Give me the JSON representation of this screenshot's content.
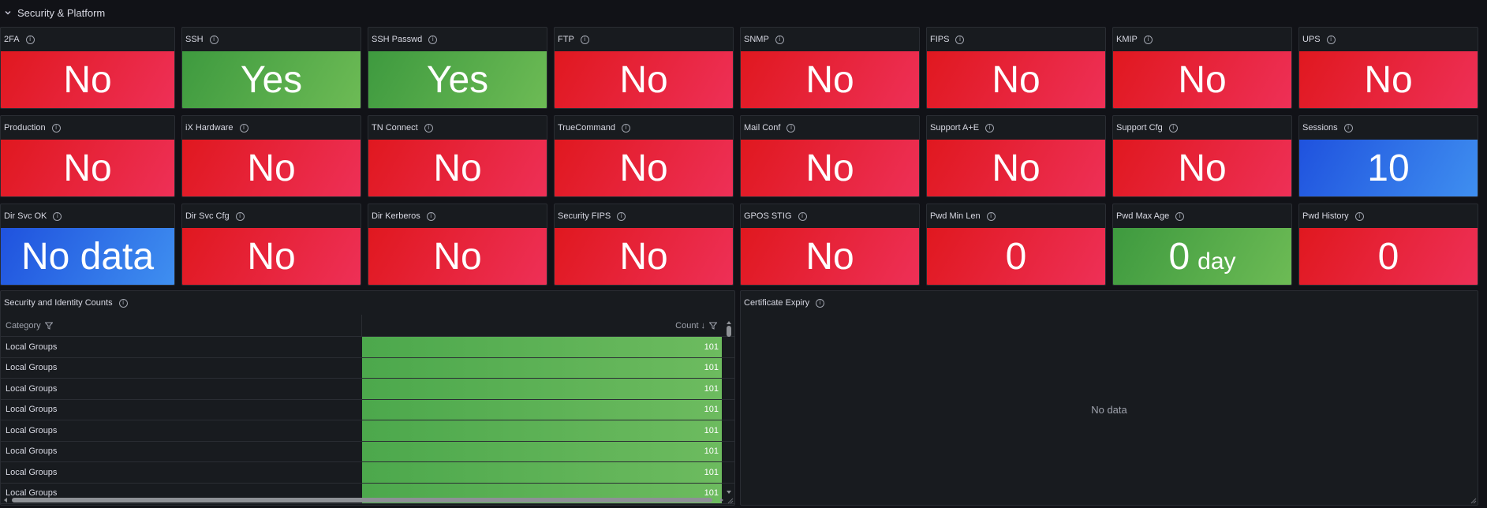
{
  "row": {
    "title": "Security & Platform"
  },
  "stats": [
    {
      "title": "2FA",
      "value": "No",
      "color": "red"
    },
    {
      "title": "SSH",
      "value": "Yes",
      "color": "green"
    },
    {
      "title": "SSH Passwd",
      "value": "Yes",
      "color": "green"
    },
    {
      "title": "FTP",
      "value": "No",
      "color": "red"
    },
    {
      "title": "SNMP",
      "value": "No",
      "color": "red"
    },
    {
      "title": "FIPS",
      "value": "No",
      "color": "red"
    },
    {
      "title": "KMIP",
      "value": "No",
      "color": "red"
    },
    {
      "title": "UPS",
      "value": "No",
      "color": "red"
    },
    {
      "title": "Production",
      "value": "No",
      "color": "red"
    },
    {
      "title": "iX Hardware",
      "value": "No",
      "color": "red"
    },
    {
      "title": "TN Connect",
      "value": "No",
      "color": "red"
    },
    {
      "title": "TrueCommand",
      "value": "No",
      "color": "red"
    },
    {
      "title": "Mail Conf",
      "value": "No",
      "color": "red"
    },
    {
      "title": "Support A+E",
      "value": "No",
      "color": "red"
    },
    {
      "title": "Support Cfg",
      "value": "No",
      "color": "red"
    },
    {
      "title": "Sessions",
      "value": "10",
      "color": "blue"
    },
    {
      "title": "Dir Svc OK",
      "value": "No data",
      "color": "blue"
    },
    {
      "title": "Dir Svc Cfg",
      "value": "No",
      "color": "red"
    },
    {
      "title": "Dir Kerberos",
      "value": "No",
      "color": "red"
    },
    {
      "title": "Security FIPS",
      "value": "No",
      "color": "red"
    },
    {
      "title": "GPOS STIG",
      "value": "No",
      "color": "red"
    },
    {
      "title": "Pwd Min Len",
      "value": "0",
      "color": "red"
    },
    {
      "title": "Pwd Max Age",
      "value": "0",
      "unit": "day",
      "color": "green"
    },
    {
      "title": "Pwd History",
      "value": "0",
      "color": "red"
    }
  ],
  "table": {
    "title": "Security and Identity Counts",
    "col_category": "Category",
    "col_count": "Count",
    "rows": [
      {
        "category": "Local Groups",
        "count": "101"
      },
      {
        "category": "Local Groups",
        "count": "101"
      },
      {
        "category": "Local Groups",
        "count": "101"
      },
      {
        "category": "Local Groups",
        "count": "101"
      },
      {
        "category": "Local Groups",
        "count": "101"
      },
      {
        "category": "Local Groups",
        "count": "101"
      },
      {
        "category": "Local Groups",
        "count": "101"
      },
      {
        "category": "Local Groups",
        "count": "101"
      }
    ]
  },
  "cert": {
    "title": "Certificate Expiry",
    "empty_text": "No data"
  },
  "colors": {
    "red": "#e0181f",
    "green": "#56a64b",
    "blue": "#1f60e0",
    "background": "#111217",
    "panel": "#181b1f"
  }
}
